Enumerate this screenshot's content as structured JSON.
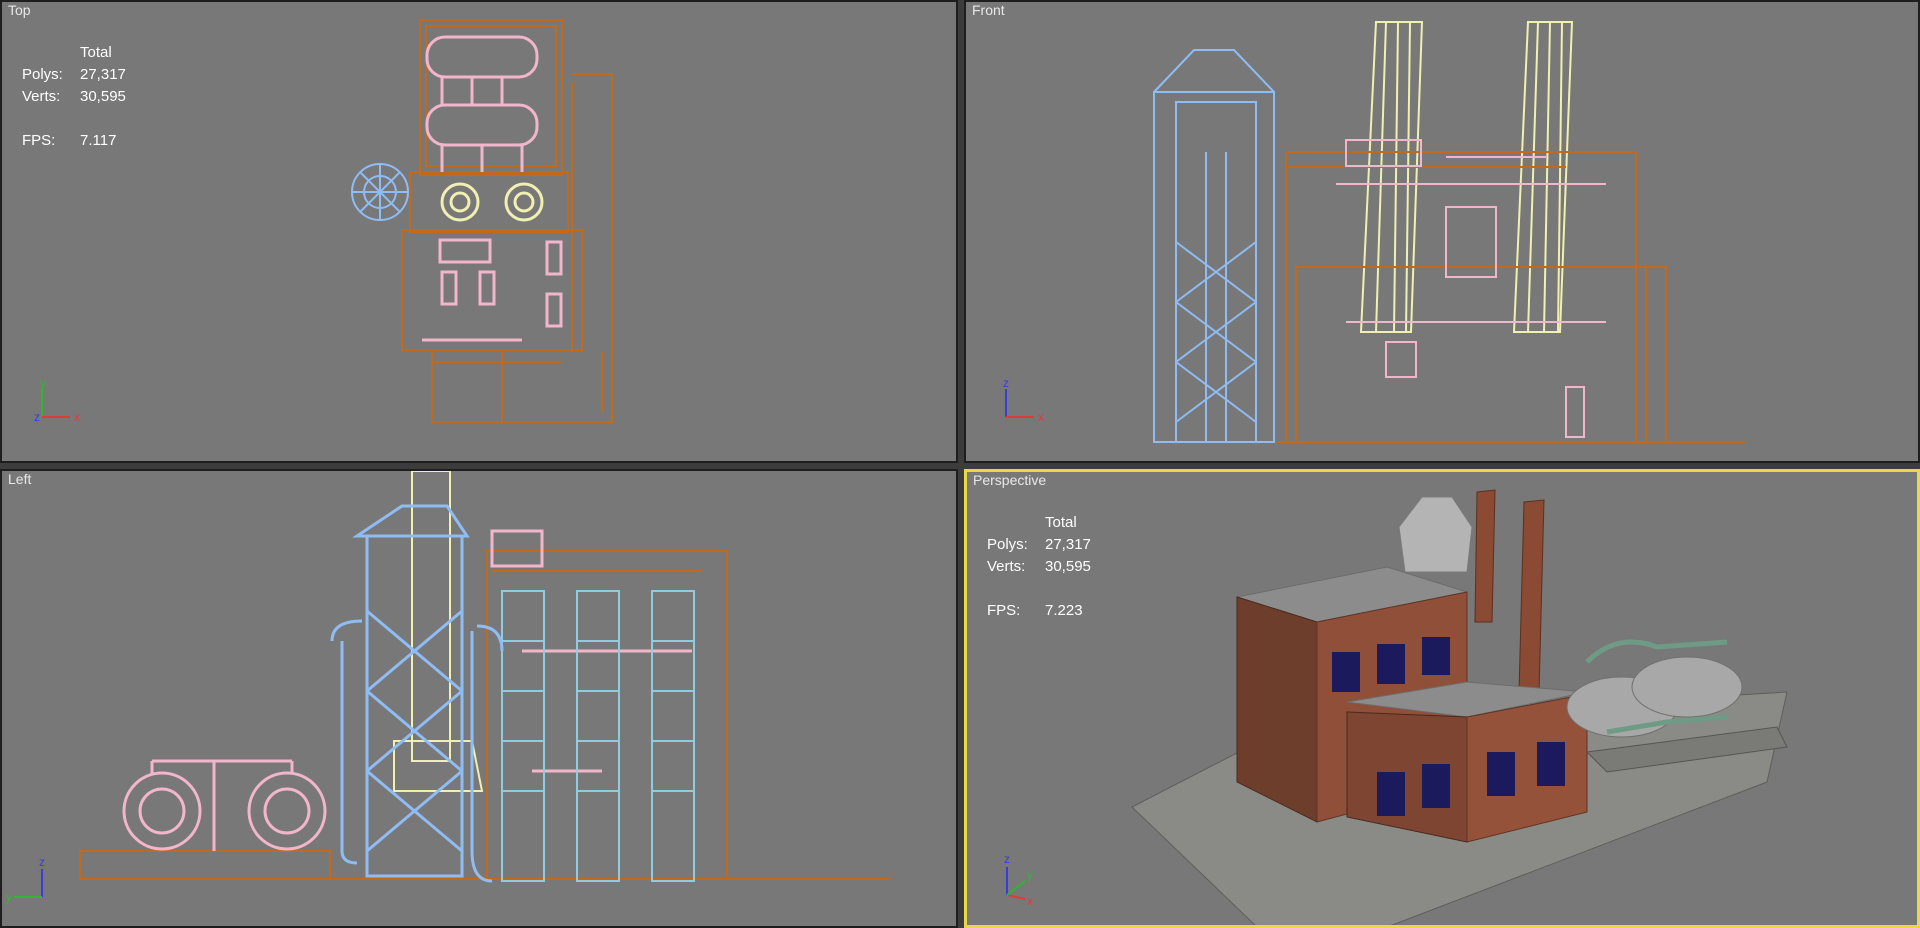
{
  "viewports": {
    "top": {
      "label": "Top"
    },
    "front": {
      "label": "Front"
    },
    "left": {
      "label": "Left"
    },
    "perspective": {
      "label": "Perspective"
    }
  },
  "stats": {
    "top": {
      "header": "Total",
      "polys_label": "Polys:",
      "polys": "27,317",
      "verts_label": "Verts:",
      "verts": "30,595",
      "fps_label": "FPS:",
      "fps": "7.117"
    },
    "perspective": {
      "header": "Total",
      "polys_label": "Polys:",
      "polys": "27,317",
      "verts_label": "Verts:",
      "verts": "30,595",
      "fps_label": "FPS:",
      "fps": "7.223"
    }
  },
  "axes": {
    "x": "x",
    "y": "y",
    "z": "z"
  },
  "colors": {
    "viewport_bg": "#787878",
    "active_border": "#e8d84a",
    "wire_orange": "#c06a1e",
    "wire_pink": "#f2b6cc",
    "wire_blue": "#8fbcf2",
    "wire_yellow": "#f0f0b0",
    "axis_x": "#e23a3a",
    "axis_y": "#2fb82f",
    "axis_z": "#3a3ae2"
  }
}
